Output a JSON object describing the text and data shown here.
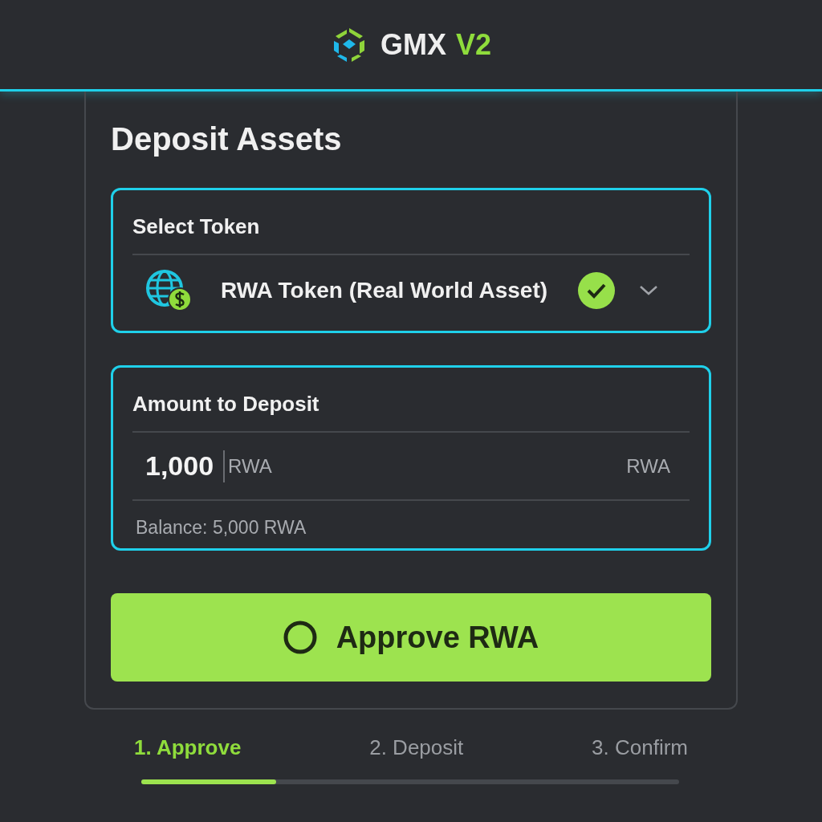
{
  "header": {
    "brand": "GMX",
    "version": "V2"
  },
  "card": {
    "title": "Deposit Assets",
    "token_select": {
      "label": "Select Token",
      "value": "RWA Token (Real World Asset)",
      "verified": true
    },
    "amount": {
      "label": "Amount to Deposit",
      "value": "1,000",
      "placeholder_unit": "RWA",
      "unit": "RWA",
      "balance": "Balance: 5,000 RWA"
    },
    "approve_button": {
      "label": "Approve RWA"
    }
  },
  "steps": [
    {
      "label": "1. Approve",
      "selected": true
    },
    {
      "label": "2. Deposit",
      "selected": false
    },
    {
      "label": "3. Confirm",
      "selected": false
    }
  ],
  "progress": {
    "level": 0.25
  }
}
